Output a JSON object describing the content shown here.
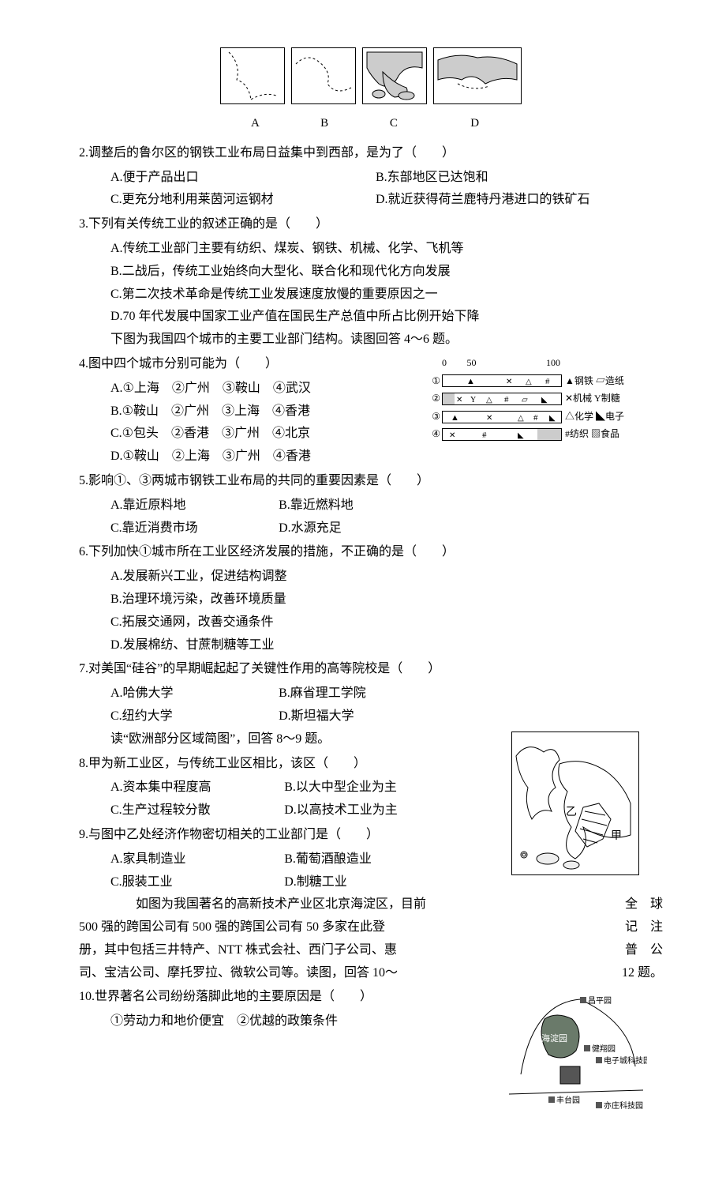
{
  "figures": {
    "top_labels": [
      "A",
      "B",
      "C",
      "D"
    ]
  },
  "q2": {
    "stem": "2.调整后的鲁尔区的钢铁工业布局日益集中到西部，是为了（　　）",
    "a": "A.便于产品出口",
    "b": "B.东部地区已达饱和",
    "c": "C.更充分地利用莱茵河运钢材",
    "d": "D.就近获得荷兰鹿特丹港进口的铁矿石"
  },
  "q3": {
    "stem": "3.下列有关传统工业的叙述正确的是（　　）",
    "a": "A.传统工业部门主要有纺织、煤炭、钢铁、机械、化学、飞机等",
    "b": "B.二战后，传统工业始终向大型化、联合化和现代化方向发展",
    "c": "C.第二次技术革命是传统工业发展速度放慢的重要原因之一",
    "d": "D.70 年代发展中国家工业产值在国民生产总值中所占比例开始下降"
  },
  "intro46": "下图为我国四个城市的主要工业部门结构。读图回答 4～6 题。",
  "q4": {
    "stem": "4.图中四个城市分别可能为（　　）",
    "a": "A.①上海　②广州　③鞍山　④武汉",
    "b": "B.①鞍山　②广州　③上海　④香港",
    "c": "C.①包头　②香港　③广州　④北京",
    "d": "D.①鞍山　②上海　③广州　④香港"
  },
  "chart_data": {
    "type": "bar",
    "axis": {
      "min": 0,
      "mid": 50,
      "max": 100
    },
    "rows": [
      "①",
      "②",
      "③",
      "④"
    ],
    "legend": [
      {
        "symbol": "▲",
        "name": "钢铁"
      },
      {
        "symbol": "▱",
        "name": "造纸"
      },
      {
        "symbol": "✕",
        "name": "机械"
      },
      {
        "symbol": "Y",
        "name": "制糖"
      },
      {
        "symbol": "△",
        "name": "化学"
      },
      {
        "symbol": "◣",
        "name": "电子"
      },
      {
        "symbol": "#",
        "name": "纺织"
      },
      {
        "symbol": "▨",
        "name": "食品"
      }
    ]
  },
  "q5": {
    "stem": "5.影响①、③两城市钢铁工业布局的共同的重要因素是（　　）",
    "a": "A.靠近原料地",
    "b": "B.靠近燃料地",
    "c": "C.靠近消费市场",
    "d": "D.水源充足"
  },
  "q6": {
    "stem": "6.下列加快①城市所在工业区经济发展的措施，不正确的是（　　）",
    "a": "A.发展新兴工业，促进结构调整",
    "b": "B.治理环境污染，改善环境质量",
    "c": "C.拓展交通网，改善交通条件",
    "d": "D.发展棉纺、甘蔗制糖等工业"
  },
  "q7": {
    "stem": "7.对美国“硅谷”的早期崛起起了关键性作用的高等院校是（　　）",
    "a": "A.哈佛大学",
    "b": "B.麻省理工学院",
    "c": "C.纽约大学",
    "d": "D.斯坦福大学"
  },
  "intro89": "读“欧洲部分区域简图”，回答 8～9 题。",
  "q8": {
    "stem": "8.甲为新工业区，与传统工业区相比，该区（　　）",
    "a": "A.资本集中程度高",
    "b": "B.以大中型企业为主",
    "c": "C.生产过程较分散",
    "d": "D.以高技术工业为主"
  },
  "q9": {
    "stem": "9.与图中乙处经济作物密切相关的工业部门是（　　）",
    "a": "A.家具制造业",
    "b": "B.葡萄酒酿造业",
    "c": "C.服装工业",
    "d": "D.制糖工业"
  },
  "intro10": {
    "l1a": "如图为我国著名的高新技术产业区北京海淀区，目前",
    "l1b": "全　球",
    "l2a": "500 强的跨国公司有 500 强的跨国公司有 50 多家在此登",
    "l2b": "记　注",
    "l3a": "册，其中包括三井特产、NTT 株式会社、西门子公司、惠",
    "l3b": "普　公",
    "l4a": "司、宝洁公司、摩托罗拉、微软公司等。读图，回答 10～",
    "l4b": "12 题。"
  },
  "q10": {
    "stem": "10.世界著名公司纷纷落脚此地的主要原因是（　　）",
    "sub": "①劳动力和地价便宜　②优越的政策条件"
  },
  "map2_labels": {
    "a": "昌平园",
    "b": "海淀园",
    "c": "健翔园",
    "d": "电子城科技园",
    "e": "丰台园",
    "f": "亦庄科技园"
  },
  "map1_labels": {
    "yi": "乙",
    "jia": "甲"
  }
}
